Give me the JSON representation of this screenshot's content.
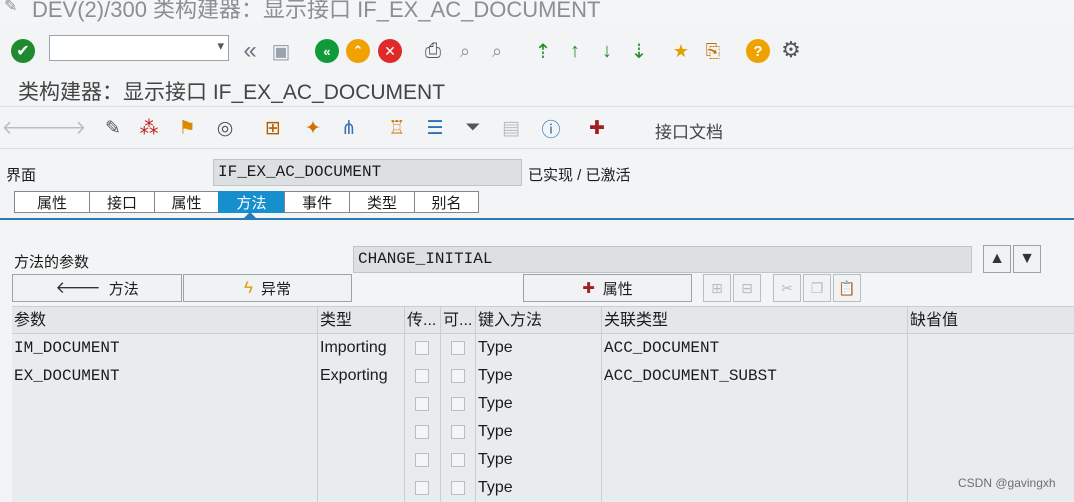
{
  "window": {
    "title": "DEV(2)/300 类构建器：显示接口 IF_EX_AC_DOCUMENT"
  },
  "app_title": "类构建器：显示接口 IF_EX_AC_DOCUMENT",
  "toolbar2": {
    "doc_label": "接口文档"
  },
  "interface": {
    "label": "界面",
    "value": "IF_EX_AC_DOCUMENT",
    "status": "已实现 / 已激活"
  },
  "tabs": [
    "属性",
    "接口",
    "属性",
    "方法",
    "事件",
    "类型",
    "别名"
  ],
  "method_params": {
    "label": "方法的参数",
    "value": "CHANGE_INITIAL"
  },
  "buttons": {
    "methods": "方法",
    "exceptions": "异常",
    "attributes": "属性"
  },
  "table": {
    "columns": [
      "参数",
      "类型",
      "传...",
      "可...",
      "键入方法",
      "关联类型",
      "缺省值"
    ],
    "rows": [
      {
        "param": "IM_DOCUMENT",
        "type": "Importing",
        "typing": "Type",
        "assoc": "ACC_DOCUMENT",
        "default": ""
      },
      {
        "param": "EX_DOCUMENT",
        "type": "Exporting",
        "typing": "Type",
        "assoc": "ACC_DOCUMENT_SUBST",
        "default": ""
      },
      {
        "param": "",
        "type": "",
        "typing": "Type",
        "assoc": "",
        "default": ""
      },
      {
        "param": "",
        "type": "",
        "typing": "Type",
        "assoc": "",
        "default": ""
      },
      {
        "param": "",
        "type": "",
        "typing": "Type",
        "assoc": "",
        "default": ""
      },
      {
        "param": "",
        "type": "",
        "typing": "Type",
        "assoc": "",
        "default": ""
      }
    ]
  },
  "watermark": "CSDN @gavingxh",
  "colors": {
    "accent": "#168fcf",
    "ok": "#1f8a2e",
    "back": "#0f9b3a",
    "exit": "#f0a300",
    "cancel": "#e02a2a"
  }
}
